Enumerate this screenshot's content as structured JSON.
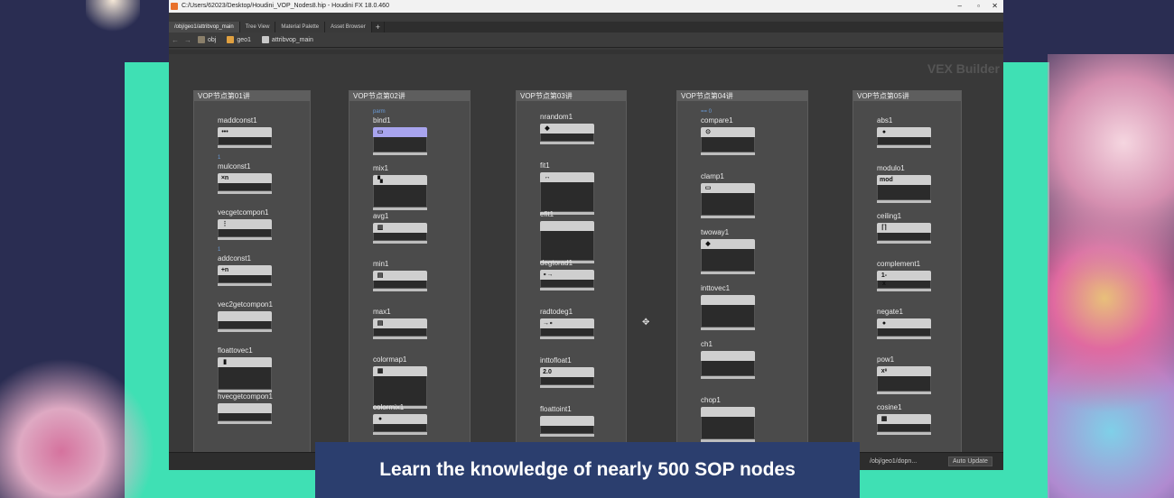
{
  "window": {
    "title": "C:/Users/62023/Desktop/Houdini_VOP_Nodes8.hip - Houdini FX 18.0.460",
    "controls": [
      "–",
      "▫",
      "✕"
    ]
  },
  "tabs": [
    {
      "label": "/obj/geo1/attribvop_main",
      "active": true
    },
    {
      "label": "Tree View"
    },
    {
      "label": "Material Palette"
    },
    {
      "label": "Asset Browser"
    },
    {
      "label": "+"
    }
  ],
  "path": {
    "back": "←",
    "forward": "→",
    "segments": [
      "obj",
      "geo1",
      "attribvop_main"
    ],
    "colors": [
      "#8a7f6a",
      "#e0a040",
      "#c8c8c8"
    ]
  },
  "network": {
    "context_label": "VEX Builder",
    "boxes": [
      {
        "title": "VOP节点第01讲",
        "nodes": [
          {
            "name": "maddconst1",
            "sym": "•••"
          },
          {
            "name": "mulconst1",
            "sym": "×n",
            "parm": "1"
          },
          {
            "name": "vecgetcompon1",
            "sym": "⋮"
          },
          {
            "name": "addconst1",
            "sym": "+n",
            "parm": "1"
          },
          {
            "name": "vec2getcompon1",
            "sym": ""
          },
          {
            "name": "floattovec1",
            "sym": "▮",
            "body": "taller"
          },
          {
            "name": "hvecgetcompon1",
            "sym": ""
          }
        ]
      },
      {
        "title": "VOP节点第02讲",
        "nodes": [
          {
            "name": "bind1",
            "sym": "▭",
            "parm": "parm",
            "kind": "parm",
            "body": "tall"
          },
          {
            "name": "mix1",
            "sym": "▚",
            "body": "taller"
          },
          {
            "name": "avg1",
            "sym": "▥"
          },
          {
            "name": "min1",
            "sym": "▤"
          },
          {
            "name": "max1",
            "sym": "▤"
          },
          {
            "name": "colormap1",
            "sym": "▦",
            "body": "tallest"
          },
          {
            "name": "colormix1",
            "sym": "●"
          }
        ]
      },
      {
        "title": "VOP节点第03讲",
        "nodes": [
          {
            "name": "nrandom1",
            "sym": "◆"
          },
          {
            "name": "fit1",
            "sym": "↔",
            "body": "tallest"
          },
          {
            "name": "efit1",
            "sym": "",
            "body": "tallest"
          },
          {
            "name": "degtorad1",
            "sym": "∘→"
          },
          {
            "name": "radtodeg1",
            "sym": "→∘"
          },
          {
            "name": "inttofloat1",
            "sym": "2.0"
          },
          {
            "name": "floattoint1",
            "sym": ""
          }
        ]
      },
      {
        "title": "VOP节点第04讲",
        "nodes": [
          {
            "name": "compare1",
            "sym": "⊙",
            "parm": "== 0",
            "body": "tall"
          },
          {
            "name": "clamp1",
            "sym": "▭",
            "body": "taller"
          },
          {
            "name": "twoway1",
            "sym": "◆",
            "body": "taller"
          },
          {
            "name": "inttovec1",
            "sym": "",
            "body": "taller"
          },
          {
            "name": "ch1",
            "sym": "",
            "body": "tall"
          },
          {
            "name": "chop1",
            "sym": "",
            "body": "taller"
          }
        ]
      },
      {
        "title": "VOP节点第05讲",
        "nodes": [
          {
            "name": "abs1",
            "sym": "●"
          },
          {
            "name": "modulo1",
            "sym": "mod",
            "body": "tall"
          },
          {
            "name": "ceiling1",
            "sym": "⌈⌉"
          },
          {
            "name": "complement1",
            "sym": "1-x"
          },
          {
            "name": "negate1",
            "sym": "●"
          },
          {
            "name": "pow1",
            "sym": "xᵉ",
            "body": "tall"
          },
          {
            "name": "cosine1",
            "sym": "▦"
          }
        ]
      }
    ]
  },
  "status": {
    "path": "/obj/geo1/dopn...",
    "auto_update": "Auto Update"
  },
  "banner": {
    "text": "Learn the knowledge of nearly 500 SOP nodes"
  }
}
